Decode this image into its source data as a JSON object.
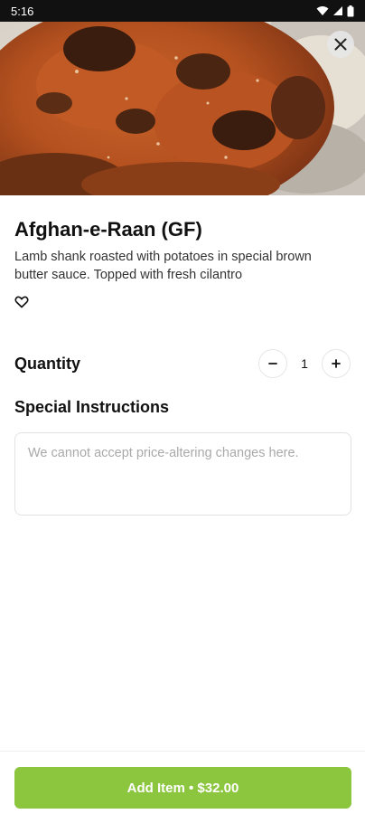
{
  "status_bar": {
    "time": "5:16",
    "icons": [
      "wifi-icon",
      "signal-icon",
      "battery-icon"
    ]
  },
  "hero": {
    "alt": "Afghan-e-Raan dish photo"
  },
  "item": {
    "title": "Afghan-e-Raan (GF)",
    "description": "Lamb shank roasted with potatoes in special brown butter sauce. Topped with fresh cilantro"
  },
  "quantity": {
    "label": "Quantity",
    "value": "1"
  },
  "special_instructions": {
    "label": "Special Instructions",
    "placeholder": "We cannot accept price-altering changes here."
  },
  "footer": {
    "add_button_label": "Add Item • $32.00"
  },
  "colors": {
    "accent": "#8cc63f",
    "status_bar": "#111111"
  }
}
